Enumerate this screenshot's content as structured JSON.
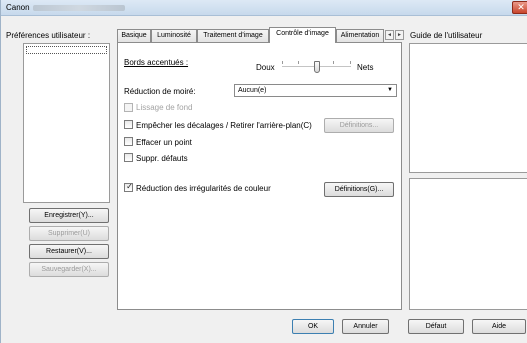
{
  "window": {
    "title": "Canon",
    "close_glyph": "✕"
  },
  "left": {
    "prefs_label": "Préférences utilisateur :",
    "buttons": {
      "save": "Enregistrer(Y)...",
      "delete": "Supprimer(U)",
      "restore": "Restaurer(V)...",
      "backup": "Sauvegarder(X)..."
    }
  },
  "tabs": {
    "items": [
      "Basique",
      "Luminosité",
      "Traitement d'image",
      "Contrôle d'image",
      "Alimentation"
    ],
    "active": "Contrôle d'image",
    "scroll_left_icon": "◄",
    "scroll_right_icon": "►"
  },
  "image_control": {
    "edge_label": "Bords accentués :",
    "edge_low": "Doux",
    "edge_high": "Nets",
    "moire_label": "Réduction de moiré:",
    "moire_value": "Aucun(e)",
    "moire_arrow": "▼",
    "smooth_bg_label": "Lissage de fond",
    "prevent_offset_label": "Empêcher les décalages / Retirer l'arrière-plan(C)",
    "settings1_label": "Définitions...",
    "erase_dot_label": "Effacer un point",
    "remove_defects_label": "Suppr. défauts",
    "color_noise_label": "Réduction des irrégularités de couleur",
    "color_noise_checked": true,
    "settings2_label": "Définitions(G)...",
    "check_glyph": "✓"
  },
  "guide": {
    "label": "Guide de l'utilisateur"
  },
  "footer": {
    "ok": "OK",
    "cancel": "Annuler",
    "default": "Défaut",
    "help": "Aide"
  },
  "colors": {
    "window_bg": "#f0f0f0",
    "titlebar": "#c7d9ec",
    "close_button": "#c8452c",
    "disabled_text": "#9b9b9b"
  }
}
